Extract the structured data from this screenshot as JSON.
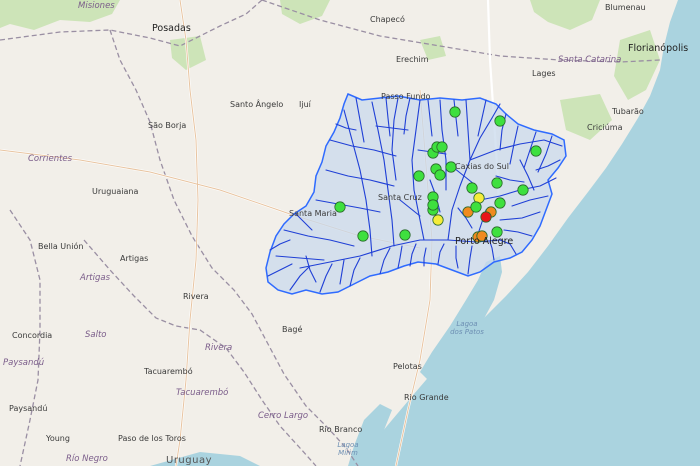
{
  "map": {
    "labels": {
      "misiones": "Misiones",
      "posadas": "Posadas",
      "chapeco": "Chapecó",
      "blumenau": "Blumenau",
      "florianopolis": "Florianópolis",
      "erechim": "Erechim",
      "santa_catarina": "Santa Catarina",
      "lages": "Lages",
      "passo_fundo": "Passo Fundo",
      "santo_angelo": "Santo Ângelo",
      "ijui": "Ijuí",
      "sao_borja": "São Borja",
      "tubarao": "Tubarão",
      "criciuma": "Criciúma",
      "corrientes": "Corrientes",
      "caxias_do_sul": "Caxias do Sul",
      "uruguaiana": "Uruguaiana",
      "santa_cruz": "Santa Cruz",
      "santa_maria": "Santa Maria",
      "bella_union": "Bella Unión",
      "artigas": "Artigas",
      "artigas_region": "Artigas",
      "porto_alegre": "Porto Alegre",
      "rivera": "Rivera",
      "bage": "Bagé",
      "salto": "Salto",
      "rivera_region": "Rivera",
      "lagoa_dos_patos": "Lagoa dos Patos",
      "concordia": "Concordia",
      "paysandu_region": "Paysandú",
      "tacuarembo": "Tacuarembó",
      "tacuarembo_region": "Tacuarembó",
      "pelotas": "Pelotas",
      "rio_grande": "Rio Grande",
      "paysandu": "Paysandú",
      "cerro_largo": "Cerro Largo",
      "young": "Young",
      "paso_de_los_toros": "Paso de los Toros",
      "rio_branco": "Rio Branco",
      "rio_negro": "Río Negro",
      "uruguay": "Uruguay",
      "lagoa_mirim": "Lagoa Mirim"
    },
    "stations": [
      {
        "status": "green"
      },
      {
        "status": "green"
      },
      {
        "status": "green"
      },
      {
        "status": "green"
      },
      {
        "status": "green"
      },
      {
        "status": "green"
      },
      {
        "status": "green"
      },
      {
        "status": "green"
      },
      {
        "status": "green"
      },
      {
        "status": "green"
      },
      {
        "status": "green"
      },
      {
        "status": "green"
      },
      {
        "status": "green"
      },
      {
        "status": "green"
      },
      {
        "status": "green"
      },
      {
        "status": "yellow"
      },
      {
        "status": "orange"
      },
      {
        "status": "orange"
      },
      {
        "status": "red"
      },
      {
        "status": "orange"
      },
      {
        "status": "green"
      },
      {
        "status": "green"
      },
      {
        "status": "green"
      },
      {
        "status": "green"
      },
      {
        "status": "yellow"
      },
      {
        "status": "green"
      },
      {
        "status": "green"
      },
      {
        "status": "green"
      },
      {
        "status": "orange"
      }
    ],
    "colors": {
      "land": "#f2efe9",
      "ocean": "#aad3df",
      "basin_fill": "#c9d9ec",
      "river": "#1f3fd6",
      "basin_outline": "#2f6bff",
      "green": "#3ee03e",
      "yellow": "#f5ec3a",
      "orange": "#f08a1e",
      "red": "#e8141a",
      "forest": "#cde4b8",
      "border": "#9a8fa3"
    }
  }
}
